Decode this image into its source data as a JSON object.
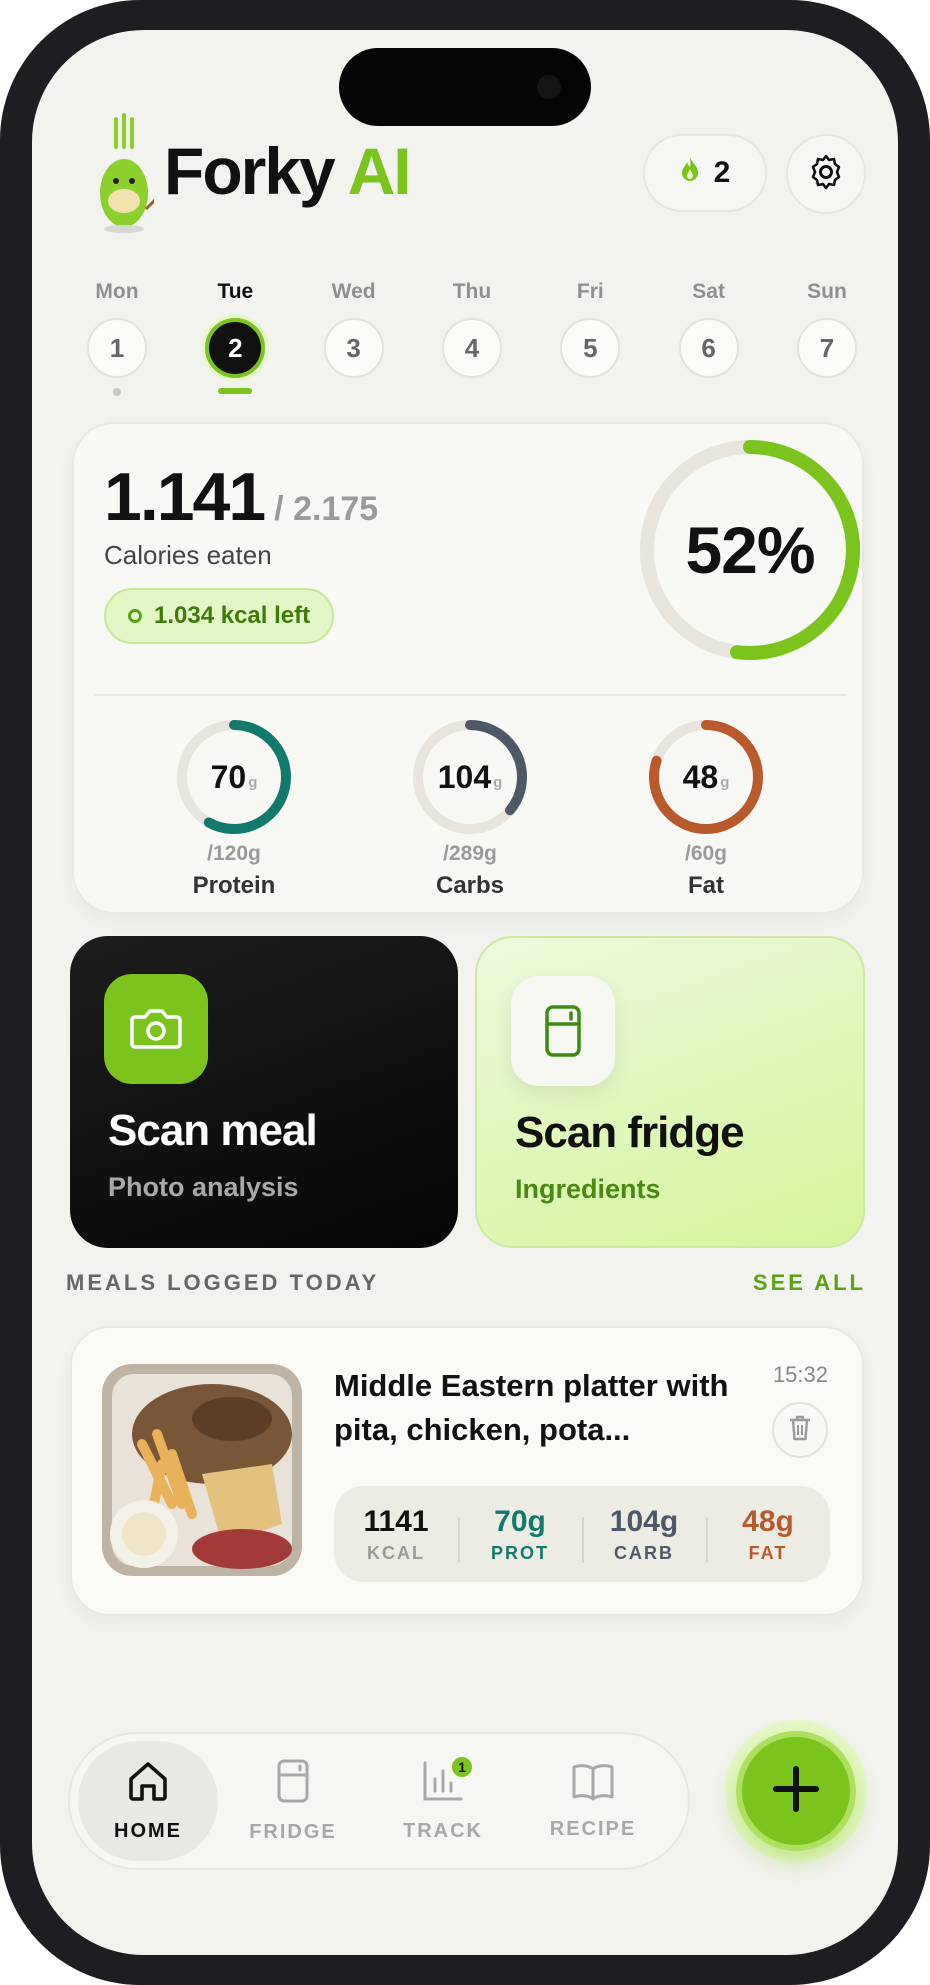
{
  "app": {
    "brand_main": "Forky",
    "brand_accent": "AI",
    "streak_count": "2",
    "accent_color": "#7bc41e"
  },
  "icons": {
    "mascot": "fork-mascot-icon",
    "streak": "flame-icon",
    "settings": "gear-icon",
    "scan_meal": "camera-icon",
    "scan_fridge": "fridge-icon",
    "delete": "trash-icon",
    "add": "plus-icon"
  },
  "week": [
    {
      "day": "Mon",
      "num": "1"
    },
    {
      "day": "Tue",
      "num": "2"
    },
    {
      "day": "Wed",
      "num": "3"
    },
    {
      "day": "Thu",
      "num": "4"
    },
    {
      "day": "Fri",
      "num": "5"
    },
    {
      "day": "Sat",
      "num": "6"
    },
    {
      "day": "Sun",
      "num": "7"
    }
  ],
  "summary": {
    "eaten": "1.141",
    "goal": "/ 2.175",
    "label": "Calories eaten",
    "left": "1.034 kcal left",
    "percent_label": "52%",
    "percent": 0.52
  },
  "macros": [
    {
      "value": "70",
      "unit": "g",
      "target": "/120g",
      "name": "Protein",
      "progress": 0.58,
      "color": "#127a6c"
    },
    {
      "value": "104",
      "unit": "g",
      "target": "/289g",
      "name": "Carbs",
      "progress": 0.36,
      "color": "#4f5866"
    },
    {
      "value": "48",
      "unit": "g",
      "target": "/60g",
      "name": "Fat",
      "progress": 0.8,
      "color": "#b85a2c"
    }
  ],
  "actions": {
    "scan_meal": {
      "title": "Scan meal",
      "subtitle": "Photo analysis"
    },
    "scan_fridge": {
      "title": "Scan fridge",
      "subtitle": "Ingredients"
    }
  },
  "meals_section": {
    "title": "MEALS LOGGED TODAY",
    "see_all": "SEE ALL"
  },
  "meal": {
    "title": "Middle Eastern platter with pita, chicken, pota...",
    "time": "15:32",
    "stats": [
      {
        "value": "1141",
        "unit": "KCAL",
        "color": "#111111",
        "unit_color": "#9a9a9a"
      },
      {
        "value": "70g",
        "unit": "PROT",
        "color": "#127a6c",
        "unit_color": "#127a6c"
      },
      {
        "value": "104g",
        "unit": "CARB",
        "color": "#4f5866",
        "unit_color": "#4f5866"
      },
      {
        "value": "48g",
        "unit": "FAT",
        "color": "#b85a2c",
        "unit_color": "#b85a2c"
      }
    ]
  },
  "nav": {
    "home": "HOME",
    "fridge": "FRIDGE",
    "track": "TRACK",
    "track_badge": "1",
    "recipe": "RECIPE"
  }
}
